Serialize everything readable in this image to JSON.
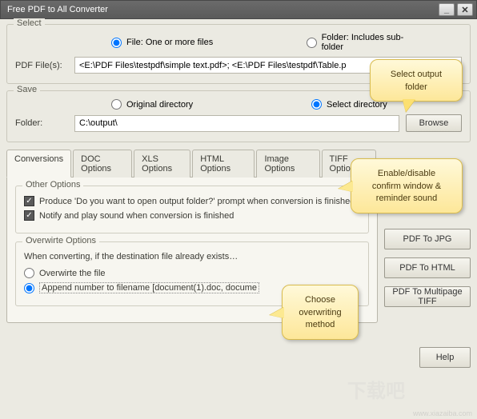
{
  "window": {
    "title": "Free PDF to All Converter"
  },
  "select": {
    "title": "Select",
    "file_label": "File:  One or more files",
    "folder_label": "Folder: Includes sub-folder",
    "pdf_label": "PDF File(s):",
    "pdf_value": "<E:\\PDF Files\\testpdf\\simple text.pdf>; <E:\\PDF Files\\testpdf\\Table.p"
  },
  "save": {
    "title": "Save",
    "original_label": "Original directory",
    "select_label": "Select directory",
    "folder_label": "Folder:",
    "folder_value": "C:\\output\\",
    "browse": "Browse"
  },
  "tabs": [
    "Conversions",
    "DOC Options",
    "XLS Options",
    "HTML Options",
    "Image Options",
    "TIFF Option"
  ],
  "other": {
    "title": "Other Options",
    "opt1": "Produce 'Do you want to open output folder?' prompt when conversion is finished",
    "opt2": "Notify and play sound when conversion is finished"
  },
  "overwrite": {
    "title": "Overwirte Options",
    "intro": "When converting, if the destination file already exists…",
    "opt1": "Overwirte the file",
    "opt2": "Append number to filename  [document(1).doc, docume"
  },
  "buttons": {
    "pdf_jpg": "PDF To JPG",
    "pdf_html": "PDF To HTML",
    "pdf_tiff": "PDF To Multipage TIFF",
    "help": "Help"
  },
  "tooltips": {
    "t1": "Select output folder",
    "t2": "Enable/disable confirm window & reminder sound",
    "t3": "Choose overwriting method"
  }
}
